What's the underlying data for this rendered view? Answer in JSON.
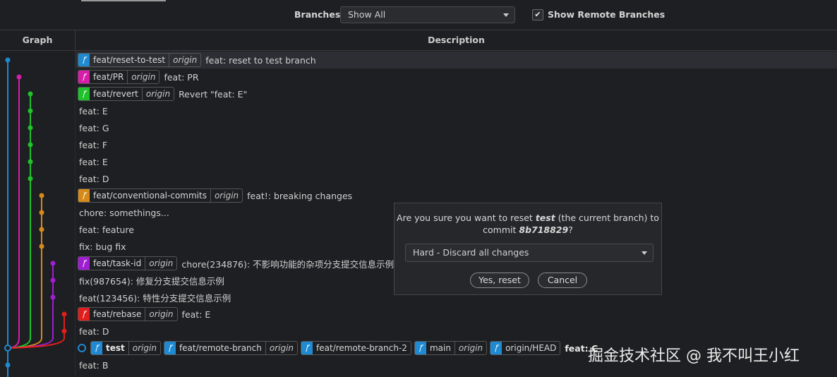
{
  "toolbar": {
    "branches_label": "Branches:",
    "branches_value": "Show All",
    "show_remote_label": "Show Remote Branches",
    "show_remote_checked": "✔"
  },
  "columns": {
    "graph": "Graph",
    "description": "Description"
  },
  "commits": [
    {
      "refs": [
        {
          "name": "feat/reset-to-test",
          "origin": "origin",
          "color": "#1f8ad2"
        }
      ],
      "message": "feat: reset to test branch",
      "selected": true
    },
    {
      "refs": [
        {
          "name": "feat/PR",
          "origin": "origin",
          "color": "#d61ea8"
        }
      ],
      "message": "feat: PR"
    },
    {
      "refs": [
        {
          "name": "feat/revert",
          "origin": "origin",
          "color": "#1fc22b"
        }
      ],
      "message": "Revert \"feat: E\""
    },
    {
      "refs": [],
      "message": "feat: E"
    },
    {
      "refs": [],
      "message": "feat: G"
    },
    {
      "refs": [],
      "message": "feat: F"
    },
    {
      "refs": [],
      "message": "feat: E"
    },
    {
      "refs": [],
      "message": "feat: D"
    },
    {
      "refs": [
        {
          "name": "feat/conventional-commits",
          "origin": "origin",
          "color": "#d68a1a"
        }
      ],
      "message": "feat!: breaking changes"
    },
    {
      "refs": [],
      "message": "chore: somethings..."
    },
    {
      "refs": [],
      "message": "feat: feature"
    },
    {
      "refs": [],
      "message": "fix: bug fix"
    },
    {
      "refs": [
        {
          "name": "feat/task-id",
          "origin": "origin",
          "color": "#a01ed2"
        }
      ],
      "message": "chore(234876): 不影响功能的杂项分支提交信息示例，"
    },
    {
      "refs": [],
      "message": "fix(987654): 修复分支提交信息示例"
    },
    {
      "refs": [],
      "message": "feat(123456): 特性分支提交信息示例"
    },
    {
      "refs": [
        {
          "name": "feat/rebase",
          "origin": "origin",
          "color": "#e01e1e"
        }
      ],
      "message": "feat: E"
    },
    {
      "refs": [],
      "message": "feat: D"
    },
    {
      "head": true,
      "refs": [
        {
          "name": "test",
          "origin": "origin",
          "color": "#1f8ad2",
          "bold": true
        },
        {
          "name": "feat/remote-branch",
          "origin": "origin",
          "color": "#1f8ad2"
        },
        {
          "name": "feat/remote-branch-2",
          "origin": "",
          "color": "#1f8ad2"
        },
        {
          "name": "main",
          "origin": "origin",
          "color": "#1f8ad2"
        },
        {
          "name": "origin/HEAD",
          "origin": "",
          "color": "#1f8ad2"
        }
      ],
      "message": "feat: C",
      "bold": true
    },
    {
      "refs": [],
      "message": "feat: B"
    }
  ],
  "lanes": [
    {
      "color": "#1f8ad2"
    },
    {
      "color": "#d61ea8"
    },
    {
      "color": "#1fc22b"
    },
    {
      "color": "#d68a1a"
    },
    {
      "color": "#a01ed2"
    },
    {
      "color": "#e01e1e"
    }
  ],
  "dialog": {
    "line1_pre": "Are you sure you want to reset ",
    "branch": "test",
    "line1_post": " (the current branch) to",
    "line2_pre": "commit ",
    "commit": "8b718829",
    "line2_post": "?",
    "mode": "Hard - Discard all changes",
    "confirm": "Yes, reset",
    "cancel": "Cancel"
  },
  "watermark": "掘金技术社区 @ 我不叫王小红"
}
